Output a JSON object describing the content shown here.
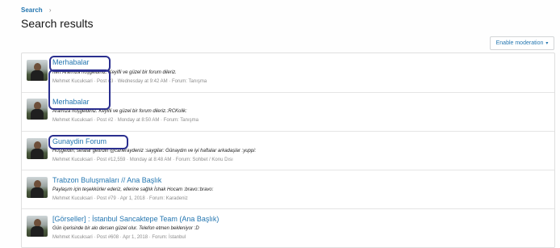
{
  "breadcrumb": {
    "search": "Search"
  },
  "page": {
    "title": "Search results"
  },
  "toolbar": {
    "moderation_label": "Enable moderation"
  },
  "results": [
    {
      "title": "Merhabalar",
      "snippet": "rtert Aramıza hoşgeldiniz. Keyifli ve güzel bir forum dileriz.",
      "meta": "Mehmet Kucuksari · Post #3 · Wednesday at 9:42 AM · Forum: Tanışma"
    },
    {
      "title": "Merhabalar",
      "snippet": "Aramıza hoşgeldiniz. Keyifli ve güzel bir forum dileriz.:RCKolik:",
      "meta": "Mehmet Kucuksari · Post #2 · Monday at 8:50 AM · Forum: Tanışma"
    },
    {
      "title": "Gunaydin Forum",
      "snippet": "Hoşgeldin, sefalar getirdin @caneraydeniz :saygilar: Günaydın ve iyi haftalar arkadaşlar :yuppi:",
      "meta": "Mehmet Kucuksari · Post #12,559 · Monday at 8:48 AM · Forum: Sohbet / Konu Dısı"
    },
    {
      "title": "Trabzon Buluşmaları // Ana Başlık",
      "snippet": "Paylaşım için teşekkürler ederiz, ellerine sağlık İshak Hocam :bravo::bravo:",
      "meta": "Mehmet Kucuksari · Post #79 · Apr 1, 2018 · Forum: Karadeniz"
    },
    {
      "title": "[Görseller] : İstanbul Sancaktepe Team (Ana Başlık)",
      "snippet": "Gün içerisinde bir alo dersen güzel olur. Telefon etmen bekleniyor :D",
      "meta": "Mehmet Kucuksari · Post #608 · Apr 1, 2018 · Forum: İstanbul"
    }
  ],
  "colors": {
    "link": "#2577b1",
    "annotation": "#2b2f8f"
  },
  "icons": {
    "breadcrumb_separator": "chevron-right-icon",
    "dropdown": "caret-down-icon"
  }
}
